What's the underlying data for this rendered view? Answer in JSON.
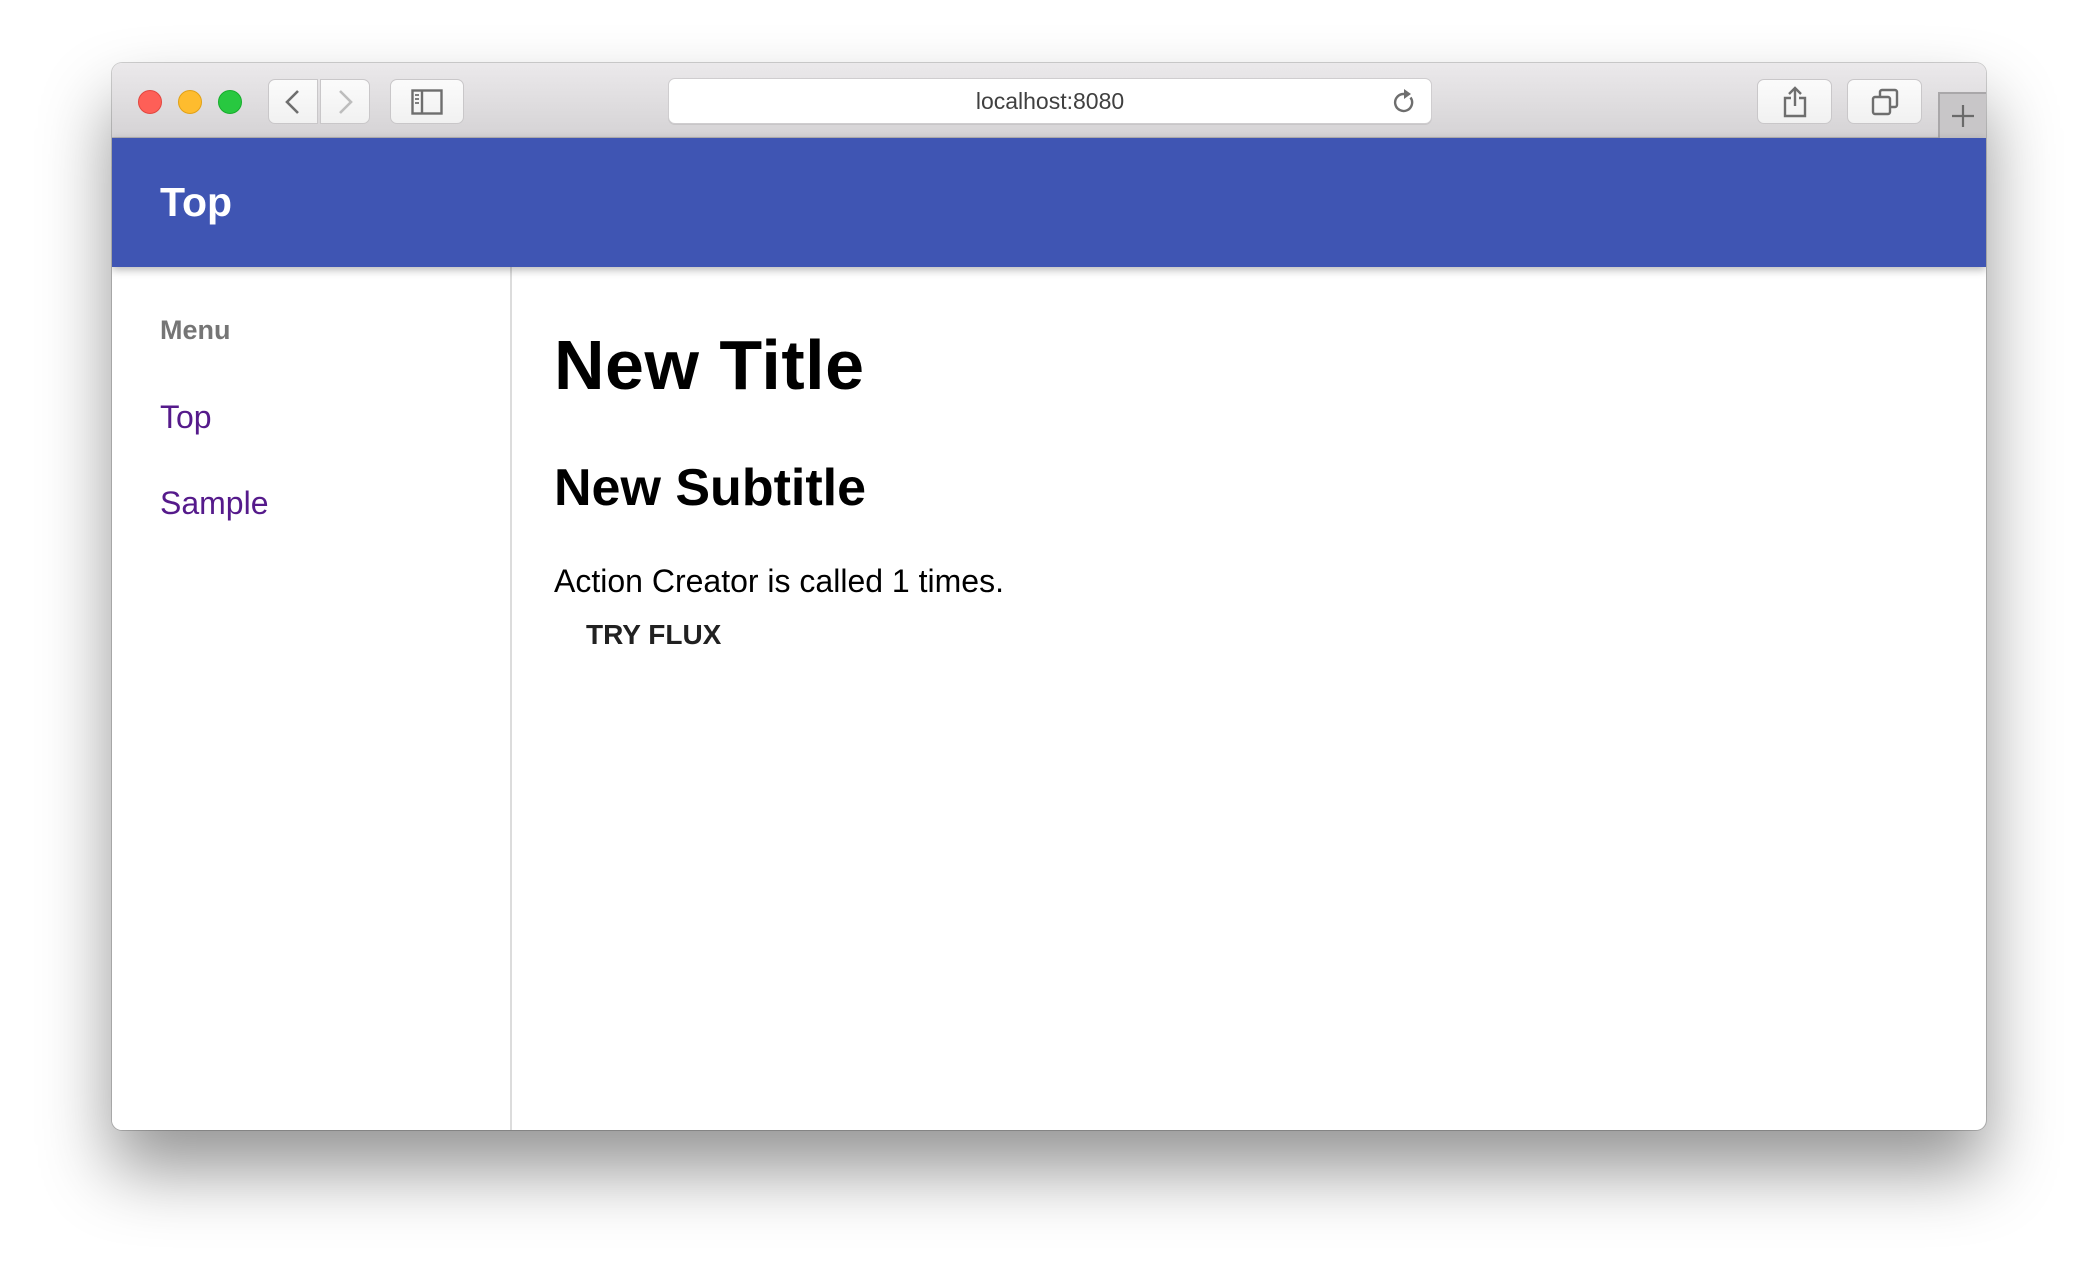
{
  "browser": {
    "url": "localhost:8080",
    "controls": {
      "close": "close-window",
      "minimize": "minimize-window",
      "zoom": "zoom-window",
      "back": "back",
      "forward": "forward",
      "sidebar": "show-sidebar",
      "reload": "reload",
      "share": "share",
      "tabs": "show-all-tabs",
      "new_tab": "new-tab"
    }
  },
  "colors": {
    "appbar": "#3f55b3",
    "link_visited": "#551a8b",
    "menu_label": "#757575"
  },
  "appbar": {
    "title": "Top"
  },
  "sidebar": {
    "menu_label": "Menu",
    "items": [
      {
        "label": "Top"
      },
      {
        "label": "Sample"
      }
    ]
  },
  "main": {
    "title": "New Title",
    "subtitle": "New Subtitle",
    "count_text": "Action Creator is called 1 times.",
    "button_label": "TRY FLUX"
  }
}
